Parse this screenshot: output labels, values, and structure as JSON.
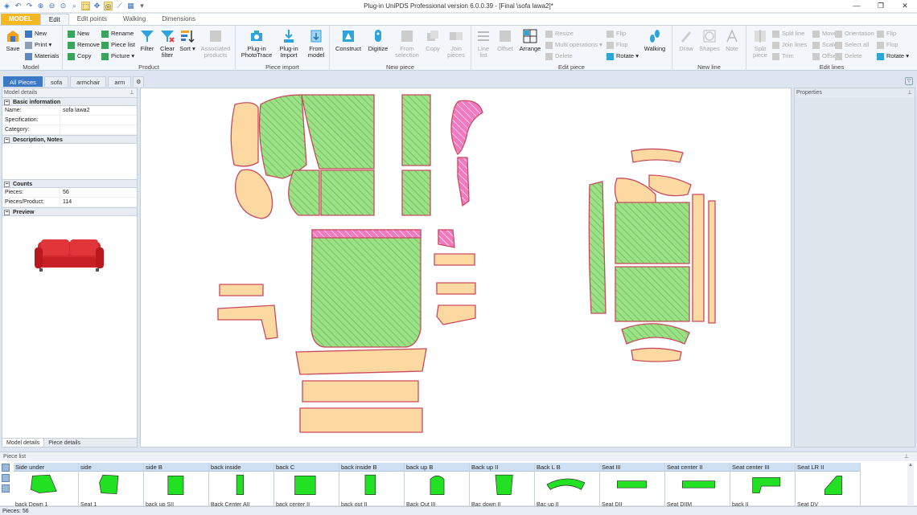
{
  "window": {
    "title": "Plug-in UniPDS Professional version 6.0.0.39 - [Final \\sofa lawa2]*",
    "controls": [
      "minimize",
      "restore",
      "close"
    ]
  },
  "quick_access": [
    "app-icon",
    "undo-icon",
    "redo-icon",
    "zoom-in-icon",
    "zoom-out-icon",
    "zoom-fit-icon",
    "zoom-window-icon",
    "select-icon",
    "pan-icon",
    "snap-icon",
    "measure-icon",
    "customize-icon"
  ],
  "ribbon_tabs": [
    "MODEL",
    "Edit",
    "Edit points",
    "Walking",
    "Dimensions"
  ],
  "ribbon": {
    "model": {
      "caption": "Model",
      "save": "Save",
      "new": "New",
      "print": "Print",
      "materials": "Materials"
    },
    "product": {
      "caption": "Product",
      "new": "New",
      "remove": "Remove",
      "copy": "Copy",
      "rename": "Rename",
      "piece_list": "Piece list",
      "picture": "Picture",
      "filter": "Filter",
      "clear_filter": "Clear filter",
      "sort": "Sort",
      "associated_products": "Associated products"
    },
    "piece_import": {
      "caption": "Piece import",
      "photo_trace": "Plug-in PhotoTrace",
      "import": "Plug-in Import",
      "from_model": "From model"
    },
    "new_piece": {
      "caption": "New piece",
      "construct": "Construct",
      "digitize": "Digitize",
      "from_selection": "From selection",
      "copy": "Copy",
      "join_pieces": "Join pieces"
    },
    "edit_piece": {
      "caption": "Edit piece",
      "line_list": "Line list",
      "offset": "Offset",
      "arrange": "Arrange",
      "resize": "Resize",
      "multi_operations": "Multi operations",
      "delete": "Delete",
      "flip": "Flip",
      "flop": "Flop",
      "rotate": "Rotate",
      "walking": "Walking"
    },
    "new_line": {
      "caption": "New line",
      "draw": "Draw",
      "shapes": "Shapes",
      "note": "Note"
    },
    "edit_lines": {
      "caption": "Edit lines",
      "split_piece": "Split piece",
      "split_line": "Split line",
      "join_lines": "Join lines",
      "trim": "Trim",
      "move": "Move",
      "scale": "Scale",
      "offset": "Offset",
      "orientation": "Orientation",
      "select_all": "Select all",
      "delete": "Delete",
      "flip": "Flip",
      "flop": "Flop",
      "rotate": "Rotate"
    }
  },
  "doc_tabs": [
    "All Pieces",
    "sofa",
    "armchair",
    "arm"
  ],
  "left_panel": {
    "title": "Model details",
    "basic_information": "Basic information",
    "fields": [
      {
        "key": "Name:",
        "value": "sofa lawa2"
      },
      {
        "key": "Specification:",
        "value": ""
      },
      {
        "key": "Category:",
        "value": ""
      }
    ],
    "description": "Description, Notes",
    "counts": "Counts",
    "count_fields": [
      {
        "key": "Pieces:",
        "value": "56"
      },
      {
        "key": "Pieces/Product:",
        "value": "114"
      }
    ],
    "preview": "Preview",
    "bottom_tabs": [
      "Model details",
      "Piece details"
    ]
  },
  "right_panel": {
    "title": "Properties"
  },
  "colors": {
    "orange_fill": "#fcd9a0",
    "green_fill": "#7fd96a",
    "pink_fill": "#f07ac0",
    "piece_outline": "#d2546a",
    "list_green": "#22e022",
    "ribbon_file": "#f7b81f",
    "active_tab": "#3b79c6"
  },
  "piece_list": {
    "title": "Piece list",
    "pieces": [
      {
        "header": "Side under",
        "name": "back Down 1"
      },
      {
        "header": "side",
        "name": "Seat 1"
      },
      {
        "header": "side B",
        "name": "back up SII"
      },
      {
        "header": "back inside",
        "name": "Back Center AII"
      },
      {
        "header": "back C",
        "name": "back center II"
      },
      {
        "header": "back inside B",
        "name": "back out II"
      },
      {
        "header": "back up B",
        "name": "Back Out III"
      },
      {
        "header": "Back up II",
        "name": "Bac down II"
      },
      {
        "header": "Back L B",
        "name": "Bac up II"
      },
      {
        "header": "Seat III",
        "name": "Seat DII"
      },
      {
        "header": "Seat center II",
        "name": "Seat DIIM"
      },
      {
        "header": "Seat center III",
        "name": "back II"
      },
      {
        "header": "Seat LR II",
        "name": "Seat DV"
      }
    ]
  },
  "status": "Pieces: 56"
}
